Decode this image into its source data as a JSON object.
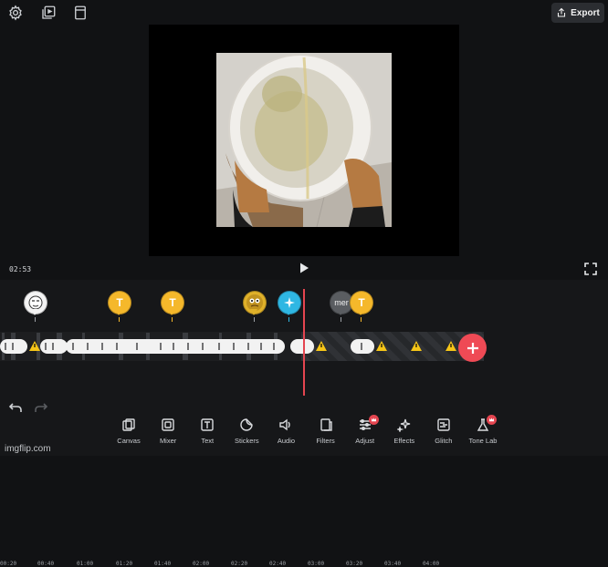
{
  "top_bar": {
    "icons": [
      "gear-icon",
      "layers-icon",
      "document-icon"
    ],
    "export_label": "Export"
  },
  "preview": {
    "current_time": "02:53"
  },
  "timeline": {
    "ruler_ticks": [
      "00:20",
      "00:40",
      "01:00",
      "01:20",
      "01:40",
      "02:00",
      "02:20",
      "02:40",
      "03:00",
      "03:20",
      "03:40",
      "04:00"
    ],
    "pin_text_label": "T",
    "pin_mer_label": "mer",
    "colors": {
      "text_pin": "#f5b82b",
      "effect_pin": "#2fb7e3",
      "playhead": "#e44550",
      "add_button": "#ef4a55",
      "warning": "#f5c518"
    }
  },
  "toolbar": {
    "items": [
      {
        "label": "Canvas",
        "icon": "canvas-icon"
      },
      {
        "label": "Mixer",
        "icon": "mixer-icon"
      },
      {
        "label": "Text",
        "icon": "text-icon"
      },
      {
        "label": "Stickers",
        "icon": "sticker-icon"
      },
      {
        "label": "Audio",
        "icon": "audio-icon"
      },
      {
        "label": "Filters",
        "icon": "filters-icon"
      },
      {
        "label": "Adjust",
        "icon": "adjust-icon",
        "premium": true
      },
      {
        "label": "Effects",
        "icon": "effects-icon"
      },
      {
        "label": "Glitch",
        "icon": "glitch-icon"
      },
      {
        "label": "Tone Lab",
        "icon": "tone-lab-icon",
        "premium": true
      }
    ]
  },
  "watermark": "imgflip.com"
}
